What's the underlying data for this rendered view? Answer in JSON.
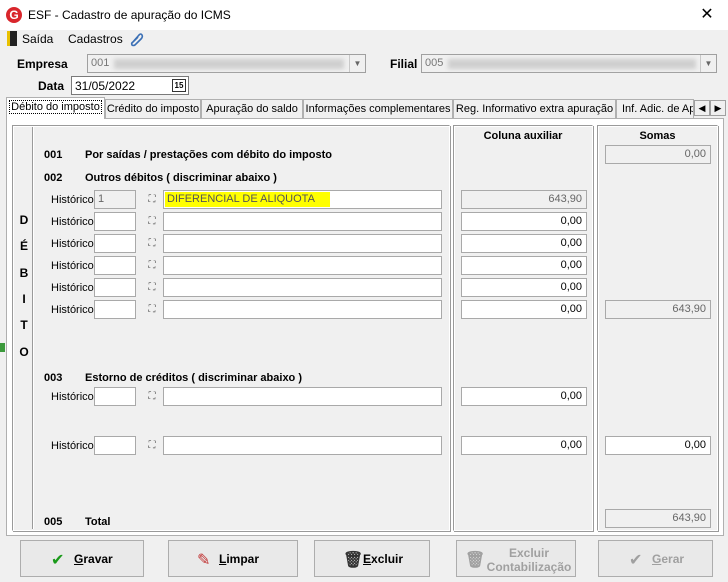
{
  "window": {
    "title": "ESF - Cadastro de apuração do ICMS",
    "app_icon": "G",
    "close": "✕"
  },
  "menu": {
    "saida": "Saída",
    "cadastros": "Cadastros"
  },
  "header": {
    "empresa_label": "Empresa",
    "empresa_value": "001",
    "filial_label": "Filial",
    "filial_value": "005",
    "data_label": "Data",
    "data_value": "31/05/2022",
    "cal_glyph": "15"
  },
  "tabs": [
    "Débito do imposto",
    "Crédito do imposto",
    "Apuração do saldo",
    "Informações complementares",
    "Reg. Informativo extra apuração",
    "Inf. Adic. de Ap"
  ],
  "vertical_label": [
    "D",
    "É",
    "B",
    "I",
    "T",
    "O"
  ],
  "columns": {
    "aux": "Coluna auxiliar",
    "somas": "Somas"
  },
  "section001": {
    "code": "001",
    "title": "Por saídas / prestações com débito do imposto",
    "soma": "0,00"
  },
  "section002": {
    "code": "002",
    "title": "Outros débitos ( discriminar abaixo )",
    "rows": [
      {
        "label": "Histórico",
        "cod": "1",
        "desc": "DIFERENCIAL DE ALIQUOTA",
        "aux": "643,90"
      },
      {
        "label": "Histórico",
        "cod": "",
        "desc": "",
        "aux": "0,00"
      },
      {
        "label": "Histórico",
        "cod": "",
        "desc": "",
        "aux": "0,00"
      },
      {
        "label": "Histórico",
        "cod": "",
        "desc": "",
        "aux": "0,00"
      },
      {
        "label": "Histórico",
        "cod": "",
        "desc": "",
        "aux": "0,00"
      },
      {
        "label": "Histórico",
        "cod": "",
        "desc": "",
        "aux": "0,00"
      }
    ],
    "soma": "643,90"
  },
  "section003": {
    "code": "003",
    "title": "Estorno de créditos ( discriminar abaixo )",
    "rows": [
      {
        "label": "Histórico",
        "aux": "0,00"
      },
      {
        "label": "Histórico",
        "aux": "0,00",
        "soma": "0,00"
      }
    ]
  },
  "section005": {
    "code": "005",
    "title": "Total",
    "soma": "643,90"
  },
  "buttons": {
    "gravar_u": "G",
    "gravar_rest": "ravar",
    "limpar_u": "L",
    "limpar_rest": "impar",
    "excluir_u": "E",
    "excluir_rest": "xcluir",
    "excluir_cont_line1": "Excluir",
    "excluir_cont_line2": "Contabilização",
    "gerar_u": "G",
    "gerar_rest": "erar"
  }
}
